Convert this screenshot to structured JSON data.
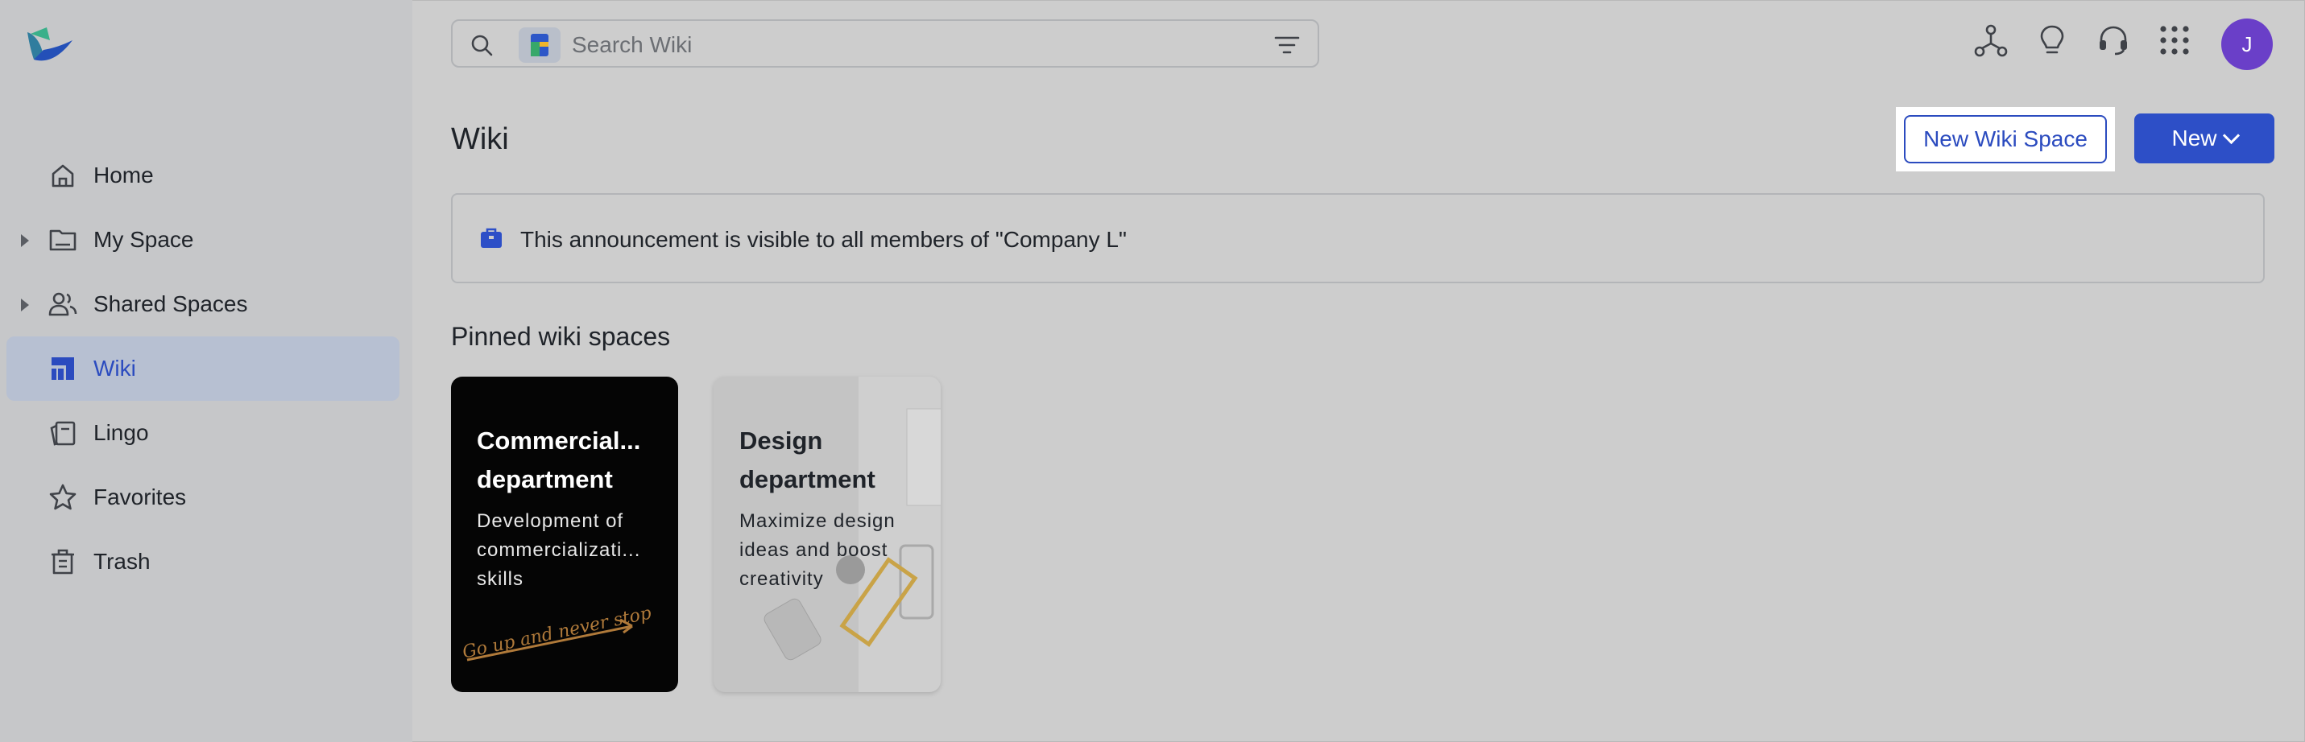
{
  "header": {
    "search_placeholder": "Search Wiki",
    "avatar_initial": "J",
    "icons": [
      "org-chart-icon",
      "lightbulb-icon",
      "headset-icon",
      "apps-grid-icon"
    ]
  },
  "sidebar": {
    "items": [
      {
        "label": "Home",
        "icon": "home-icon",
        "expandable": false,
        "active": false
      },
      {
        "label": "My Space",
        "icon": "folder-icon",
        "expandable": true,
        "active": false
      },
      {
        "label": "Shared Spaces",
        "icon": "people-icon",
        "expandable": true,
        "active": false
      },
      {
        "label": "Wiki",
        "icon": "wiki-icon",
        "expandable": false,
        "active": true
      },
      {
        "label": "Lingo",
        "icon": "lingo-icon",
        "expandable": false,
        "active": false
      },
      {
        "label": "Favorites",
        "icon": "star-icon",
        "expandable": false,
        "active": false
      },
      {
        "label": "Trash",
        "icon": "trash-icon",
        "expandable": false,
        "active": false
      }
    ]
  },
  "main": {
    "title": "Wiki",
    "new_wiki_space_label": "New Wiki Space",
    "new_label": "New",
    "announcement": "This announcement is visible to all members of \"Company L\"",
    "pinned_title": "Pinned wiki spaces",
    "cards": [
      {
        "title": "Commercial... department",
        "description": "Development of commercializati... skills",
        "art_text": "Go up and never stop"
      },
      {
        "title": "Design department",
        "description": "Maximize design ideas and boost creativity"
      }
    ]
  },
  "colors": {
    "accent": "#2d4fc7",
    "avatar": "#6a3fc8",
    "active_nav_bg": "#b7c0d2"
  }
}
